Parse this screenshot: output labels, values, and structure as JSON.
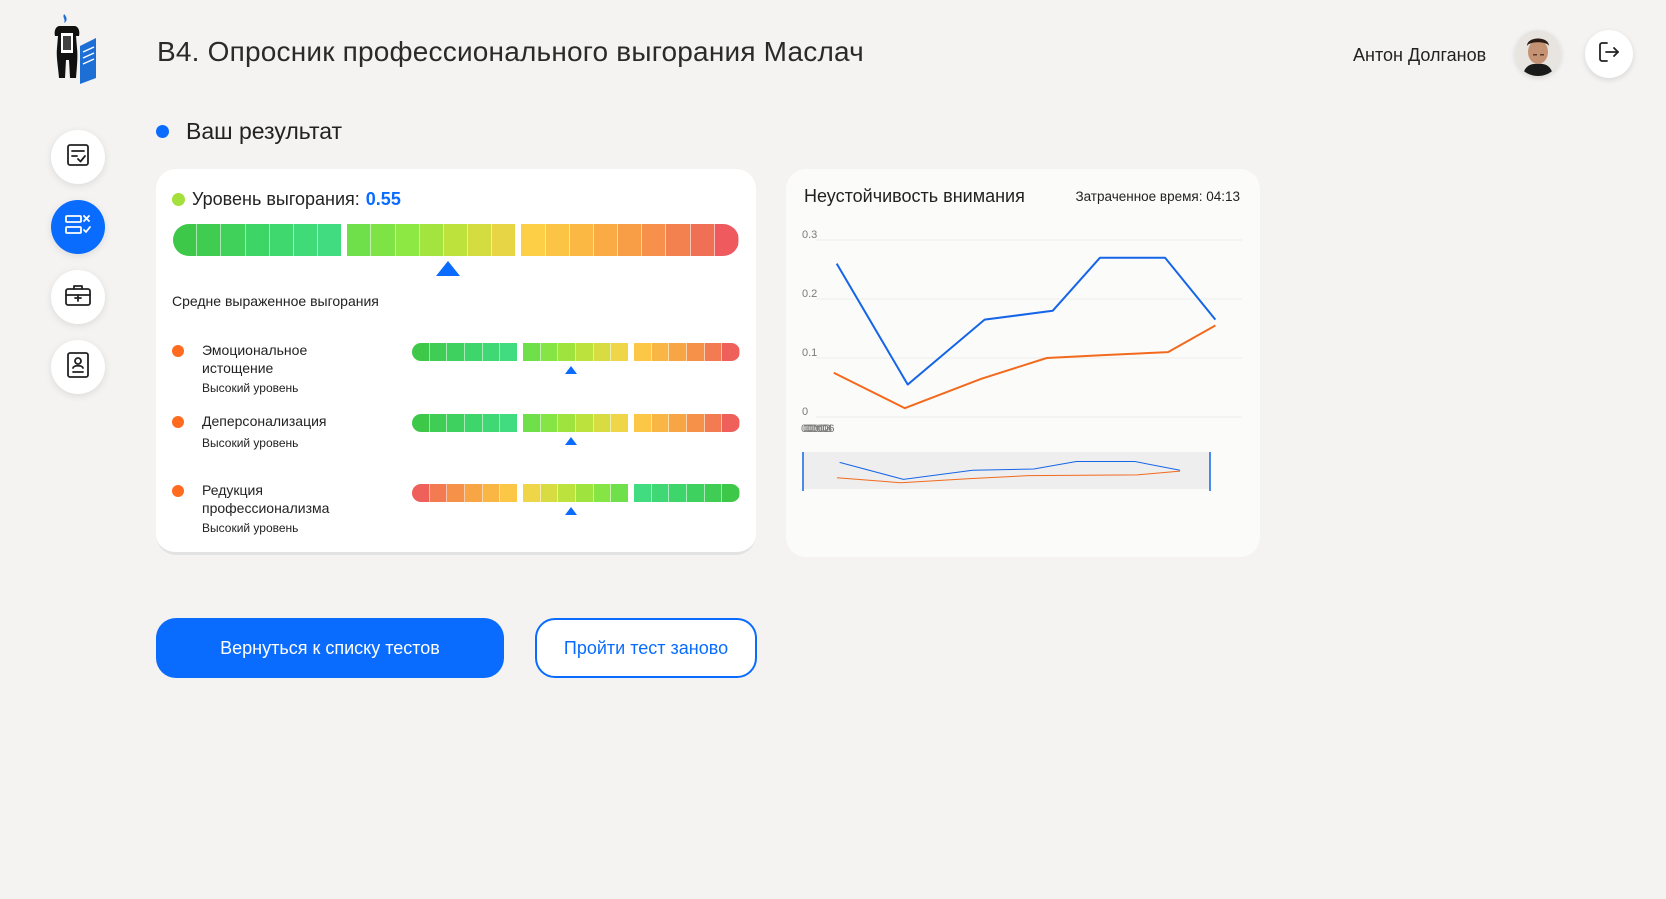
{
  "header": {
    "title": "B4. Опросник профессионального выгорания Маслач",
    "user_name": "Антон Долганов"
  },
  "sidebar": {
    "items": [
      {
        "name": "tests-list",
        "icon": "checklist-icon",
        "active": false
      },
      {
        "name": "test-results",
        "icon": "results-icon",
        "active": true
      },
      {
        "name": "first-aid",
        "icon": "medkit-icon",
        "active": false
      },
      {
        "name": "profile",
        "icon": "badge-icon",
        "active": false
      }
    ]
  },
  "result": {
    "heading": "Ваш результат",
    "level_label": "Уровень выгорания:",
    "level_value": "0.55",
    "level_fraction": 0.485,
    "level_description": "Средне выраженное выгорания",
    "subscales": [
      {
        "name": "Эмоциональное истощение",
        "level": "Высокий уровень",
        "position": 0.485,
        "scale": "green-to-red"
      },
      {
        "name": "Деперсонализация",
        "level": "Высокий уровень",
        "position": 0.485,
        "scale": "green-to-red"
      },
      {
        "name": "Редукция профессионализма",
        "level": "Высокий уровень",
        "position": 0.485,
        "scale": "red-to-green"
      }
    ]
  },
  "attention_chart": {
    "title": "Неустойчивость внимания",
    "time_label": "Затраченное время: 04:13"
  },
  "chart_data": {
    "type": "line",
    "x": [
      "00:00",
      "00:01",
      "00:02",
      "00:03",
      "00:04",
      "00:05",
      "00:06",
      "00:07"
    ],
    "x_values_min": [
      0.3,
      1.5,
      2.7,
      3.8,
      4.9,
      6.0,
      7.0
    ],
    "series": [
      {
        "color": "#1565e8",
        "x": [
          0.35,
          1.55,
          2.85,
          4.0,
          4.8,
          5.9,
          6.75
        ],
        "values": [
          0.26,
          0.055,
          0.165,
          0.18,
          0.27,
          0.27,
          0.165
        ]
      },
      {
        "color": "#f26a1e",
        "x": [
          0.3,
          1.5,
          2.8,
          3.9,
          4.9,
          5.95,
          6.75
        ],
        "values": [
          0.075,
          0.015,
          0.065,
          0.1,
          0.105,
          0.11,
          0.155
        ]
      }
    ],
    "yticks": [
      "0",
      "0.1",
      "0.2",
      "0.3"
    ],
    "xticks": [
      "00:00",
      "00:02",
      "00:04",
      "00:06"
    ],
    "ylim": [
      0,
      0.3
    ],
    "xlim": [
      0,
      7.2
    ]
  },
  "actions": {
    "back_label": "Вернуться к списку тестов",
    "retake_label": "Пройти тест заново"
  }
}
